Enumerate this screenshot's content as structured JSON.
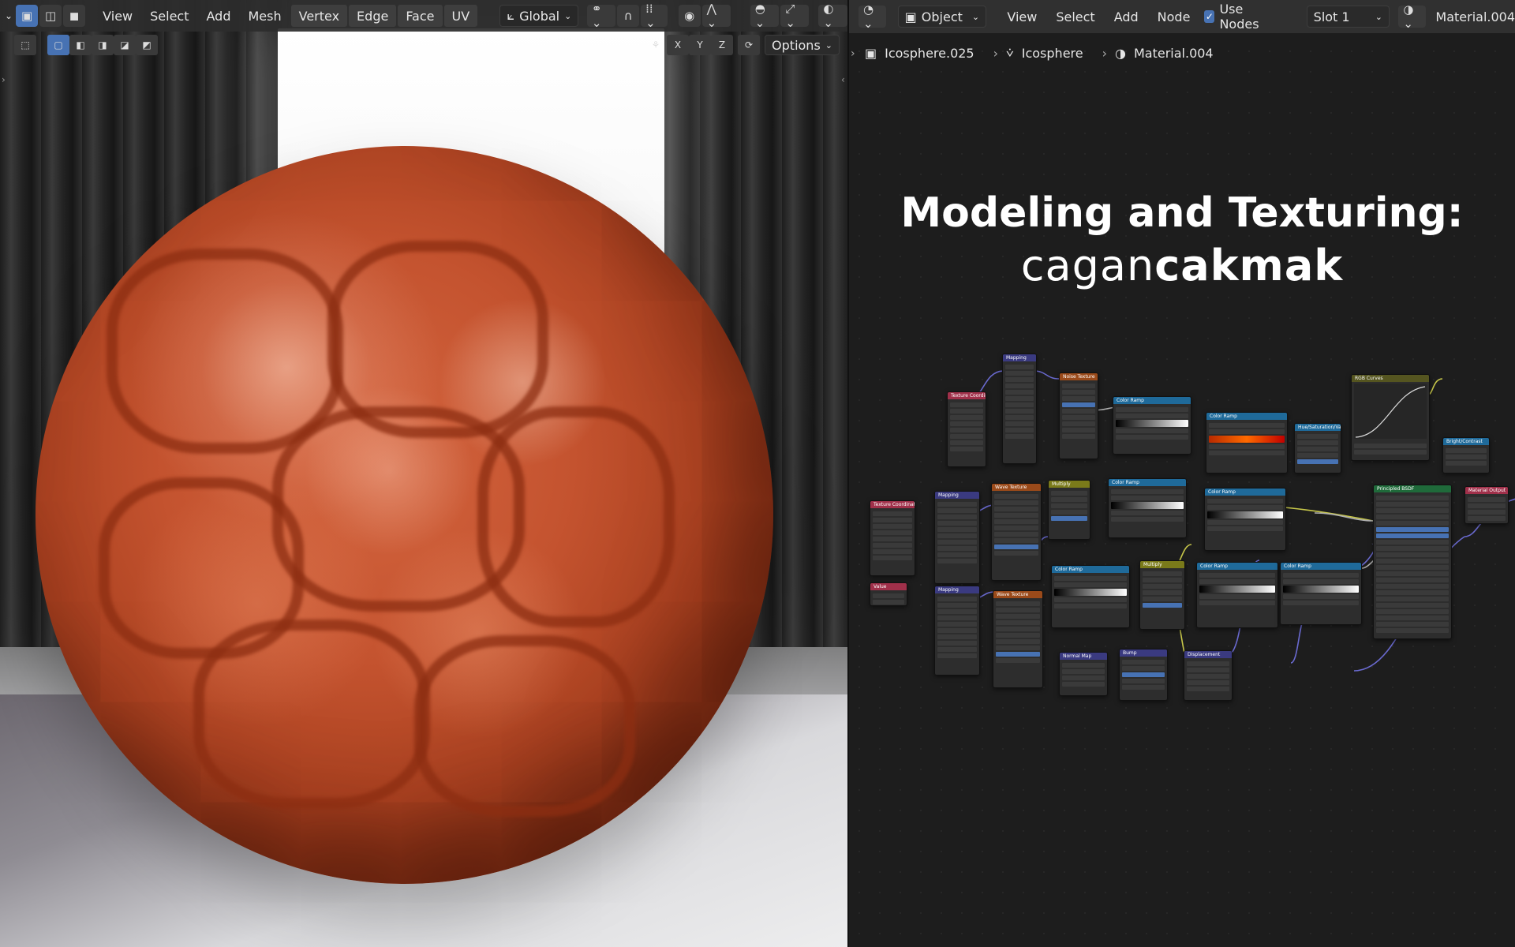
{
  "viewport": {
    "menus": [
      "View",
      "Select",
      "Add",
      "Mesh",
      "Vertex",
      "Edge",
      "Face",
      "UV"
    ],
    "transform_orientation": "Global",
    "axes": [
      "X",
      "Y",
      "Z"
    ],
    "options_label": "Options"
  },
  "node_editor": {
    "mode": "Object",
    "menus": [
      "View",
      "Select",
      "Add",
      "Node"
    ],
    "use_nodes_label": "Use Nodes",
    "use_nodes_checked": true,
    "slot": "Slot 1",
    "material": "Material.004",
    "breadcrumb": {
      "object": "Icosphere.025",
      "mesh": "Icosphere",
      "material": "Material.004"
    },
    "overlay": {
      "title": "Modeling and Texturing:",
      "author_light": "cagan",
      "author_bold": "cakmak"
    },
    "nodes": [
      {
        "label": "Mapping",
        "color": "#3a3a80"
      },
      {
        "label": "Noise Texture",
        "color": "#9a4a1a"
      },
      {
        "label": "Color Ramp",
        "color": "#1f6a9a"
      },
      {
        "label": "Color Ramp",
        "color": "#1f6a9a"
      },
      {
        "label": "Hue/Saturation/Value",
        "color": "#1f6a9a"
      },
      {
        "label": "RGB Curves",
        "color": "#555520"
      },
      {
        "label": "Bright/Contrast",
        "color": "#1f6a9a"
      },
      {
        "label": "Texture Coordinate",
        "color": "#a0304a"
      },
      {
        "label": "Texture Coordinate",
        "color": "#a0304a"
      },
      {
        "label": "Mapping",
        "color": "#3a3a80"
      },
      {
        "label": "Wave Texture",
        "color": "#9a4a1a"
      },
      {
        "label": "Multiply",
        "color": "#7a7a1a"
      },
      {
        "label": "Color Ramp",
        "color": "#1f6a9a"
      },
      {
        "label": "Color Ramp",
        "color": "#1f6a9a"
      },
      {
        "label": "Principled BSDF",
        "color": "#1f6a3a"
      },
      {
        "label": "Material Output",
        "color": "#a0304a"
      },
      {
        "label": "Value",
        "color": "#a0304a"
      },
      {
        "label": "Mapping",
        "color": "#3a3a80"
      },
      {
        "label": "Wave Texture",
        "color": "#9a4a1a"
      },
      {
        "label": "Color Ramp",
        "color": "#1f6a9a"
      },
      {
        "label": "Multiply",
        "color": "#7a7a1a"
      },
      {
        "label": "Color Ramp",
        "color": "#1f6a9a"
      },
      {
        "label": "Color Ramp",
        "color": "#1f6a9a"
      },
      {
        "label": "Normal Map",
        "color": "#3a3a80"
      },
      {
        "label": "Bump",
        "color": "#3a3a80"
      },
      {
        "label": "Displacement",
        "color": "#3a3a80"
      }
    ]
  }
}
